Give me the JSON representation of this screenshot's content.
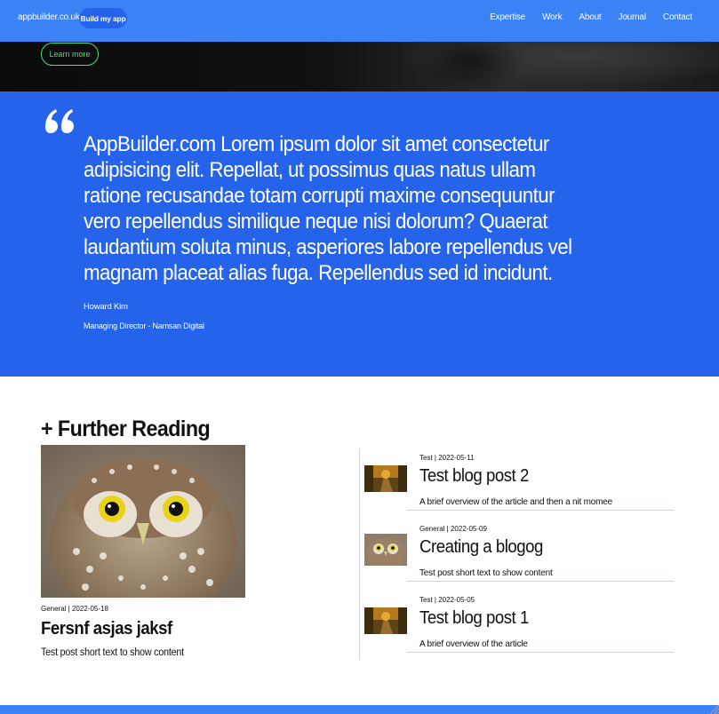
{
  "nav": {
    "brand": "appbuilder.co.uk",
    "cta": "Build my app",
    "links": [
      "Expertise",
      "Work",
      "About",
      "Journal",
      "Contact"
    ]
  },
  "hero": {
    "learn_more": "Learn more"
  },
  "testimonial": {
    "quote": "AppBuilder.com Lorem ipsum dolor sit amet consectetur adipisicing elit. Repellat, ut possimus quas natus ullam ratione recusandae totam corrupti maxime consequuntur vero repellendus similique neque nisi dolorum? Quaerat laudantium soluta minus, asperiores labore repellendus vel magnam placeat alias fuga. Repellendus sed id incidunt.",
    "author": "Howard Kim",
    "role": "Managing Director - Namsan Digital"
  },
  "further_reading": {
    "title": "+ Further Reading",
    "featured": {
      "meta": "General | 2022-05-18",
      "title": "Fersnf asjas jaksf",
      "desc": "Test post short text to show content"
    },
    "posts": [
      {
        "meta": "Test | 2022-05-11",
        "title": "Test blog post 2",
        "desc": "A brief overview of the article and then a nit momee",
        "thumb": "forest-road"
      },
      {
        "meta": "General | 2022-05-09",
        "title": "Creating a blogog",
        "desc": "Test post short text to show content",
        "thumb": "owl"
      },
      {
        "meta": "Test | 2022-05-05",
        "title": "Test blog post 1",
        "desc": "A brief overview of the article",
        "thumb": "forest-road"
      }
    ]
  },
  "colors": {
    "nav": "#3b82f6",
    "quote_bg": "#2563eb",
    "accent_green": "#4ade80"
  }
}
